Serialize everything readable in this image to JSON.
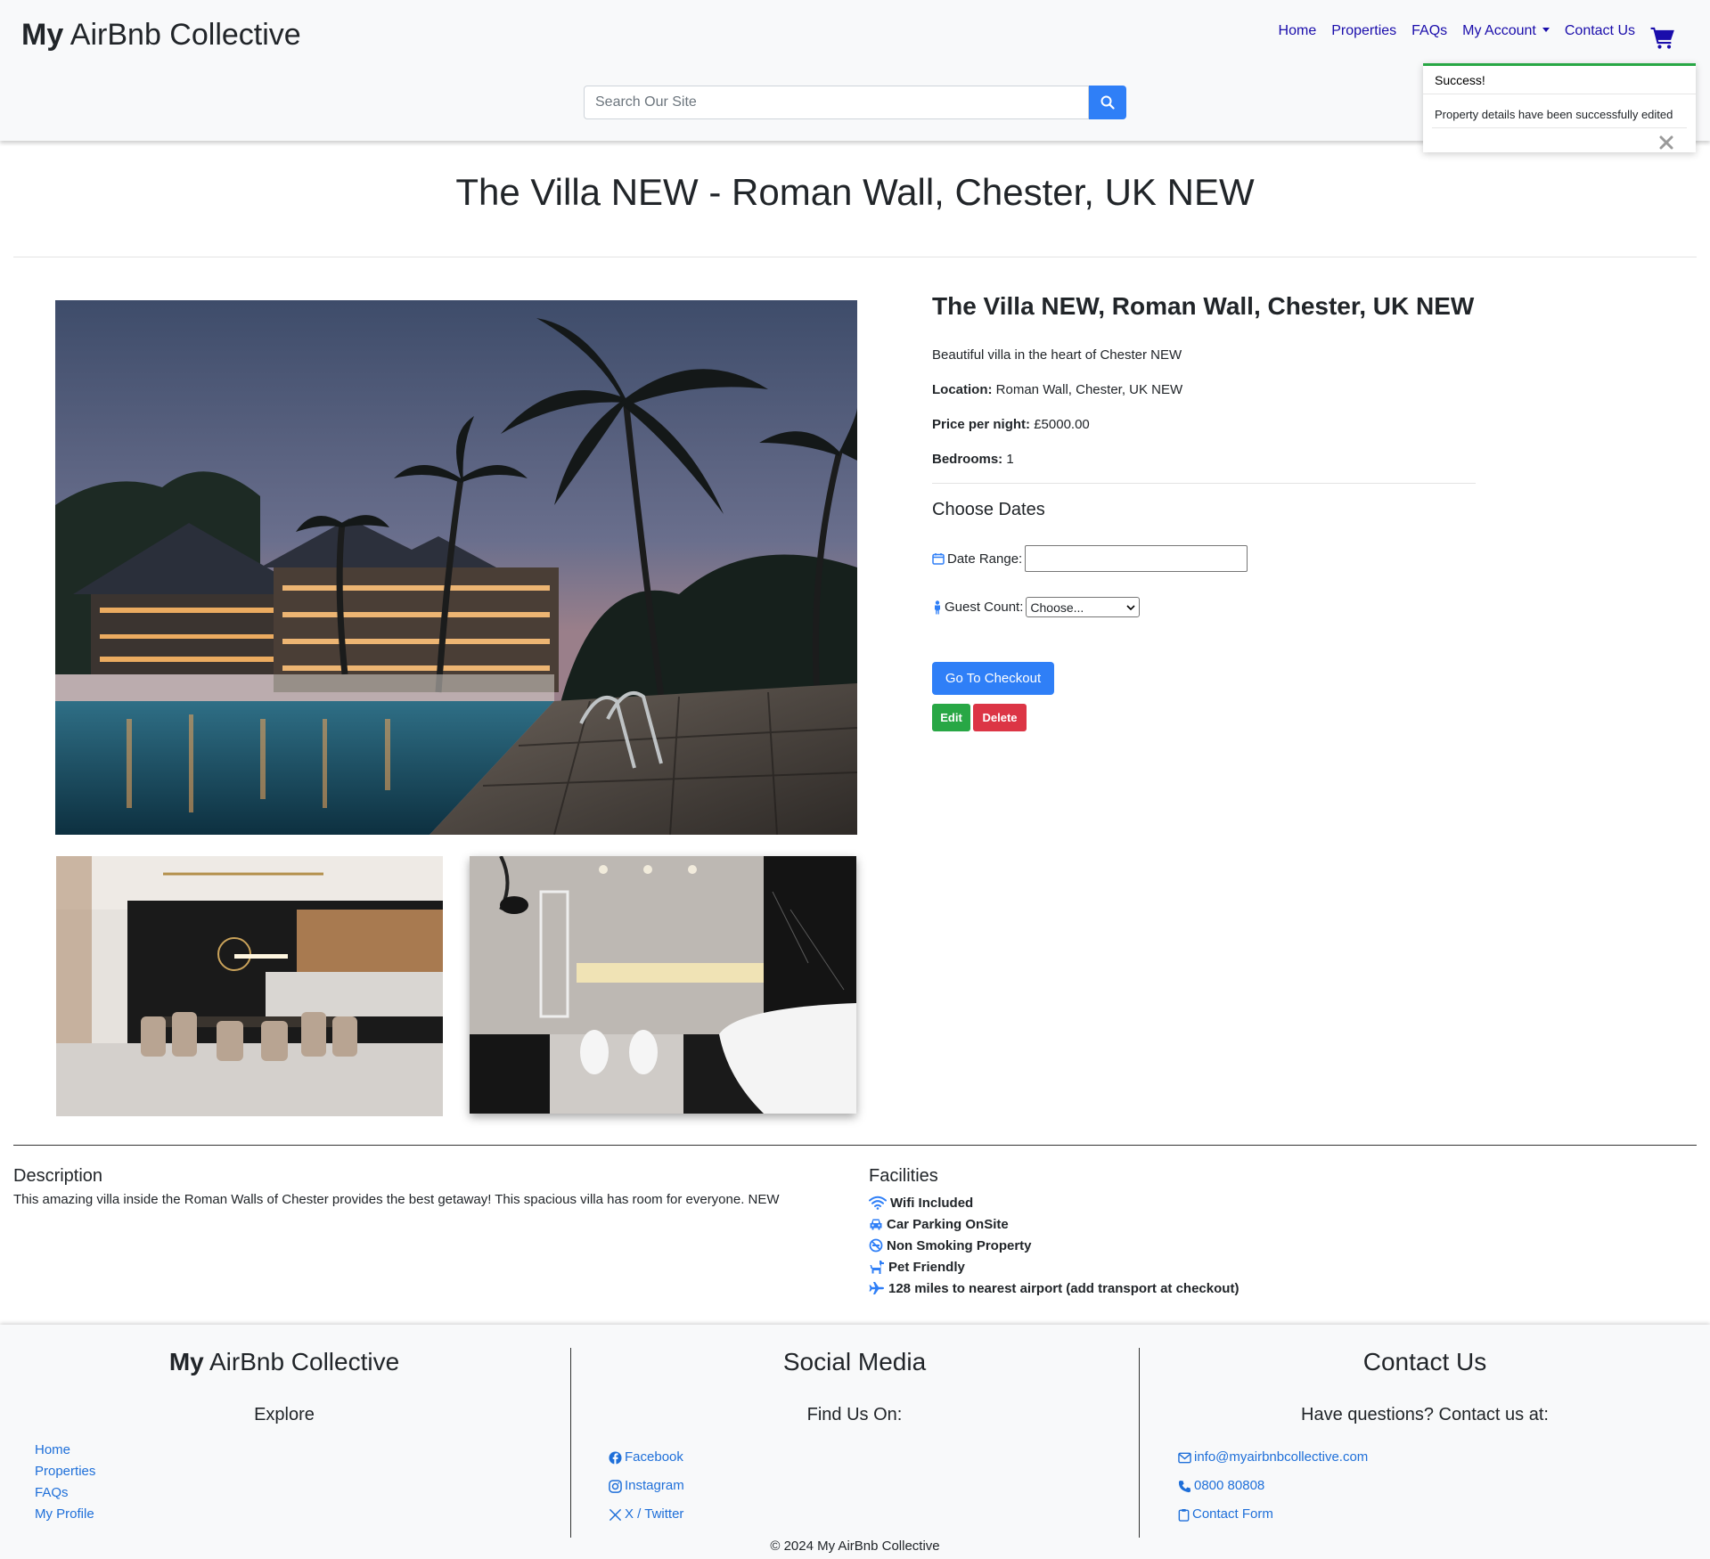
{
  "header": {
    "brand_bold": "My",
    "brand_rest": " AirBnb Collective",
    "nav": [
      "Home",
      "Properties",
      "FAQs",
      "My Account",
      "Contact Us"
    ],
    "search_placeholder": "Search Our Site"
  },
  "toast": {
    "title": "Success!",
    "message": "Property details have been successfully edited"
  },
  "page_title": "The Villa NEW - Roman Wall, Chester, UK NEW",
  "details": {
    "title": "The Villa NEW, Roman Wall, Chester, UK NEW",
    "short_description": "Beautiful villa in the heart of Chester NEW",
    "location_label": "Location:",
    "location": "Roman Wall, Chester, UK NEW",
    "price_label": "Price per night:",
    "price": "£5000.00",
    "bedrooms_label": "Bedrooms:",
    "bedrooms": "1",
    "choose_dates": "Choose Dates",
    "date_range_label": "Date Range:",
    "guest_count_label": "Guest Count:",
    "guest_count_value": "Choose...",
    "checkout_label": "Go To Checkout",
    "edit_label": "Edit",
    "delete_label": "Delete"
  },
  "description": {
    "heading": "Description",
    "text": "This amazing villa inside the Roman Walls of Chester provides the best getaway! This spacious villa has room for everyone. NEW"
  },
  "facilities": {
    "heading": "Facilities",
    "items": [
      {
        "icon": "wifi-icon",
        "label": "Wifi Included"
      },
      {
        "icon": "car-icon",
        "label": "Car Parking OnSite"
      },
      {
        "icon": "no-smoking-icon",
        "label": "Non Smoking Property"
      },
      {
        "icon": "dog-icon",
        "label": "Pet Friendly"
      },
      {
        "icon": "plane-icon",
        "label": "128 miles to nearest airport (add transport at checkout)"
      }
    ]
  },
  "footer": {
    "brand_bold": "My",
    "brand_rest": " AirBnb Collective",
    "explore": "Explore",
    "explore_links": [
      "Home",
      "Properties",
      "FAQs",
      "My Profile"
    ],
    "social_title": "Social Media",
    "find_us": "Find Us On:",
    "social_links": [
      "Facebook",
      "Instagram",
      "X / Twitter"
    ],
    "contact_title": "Contact Us",
    "contact_sub": "Have questions? Contact us at:",
    "contact_links": [
      "info@myairbnbcollective.com",
      "0800 80808",
      "Contact Form"
    ],
    "copyright": "© 2024 My AirBnb Collective"
  },
  "colors": {
    "accent": "#2f7ff7",
    "success": "#28a745",
    "danger": "#dc3545",
    "nav_link": "#1a0dab"
  }
}
